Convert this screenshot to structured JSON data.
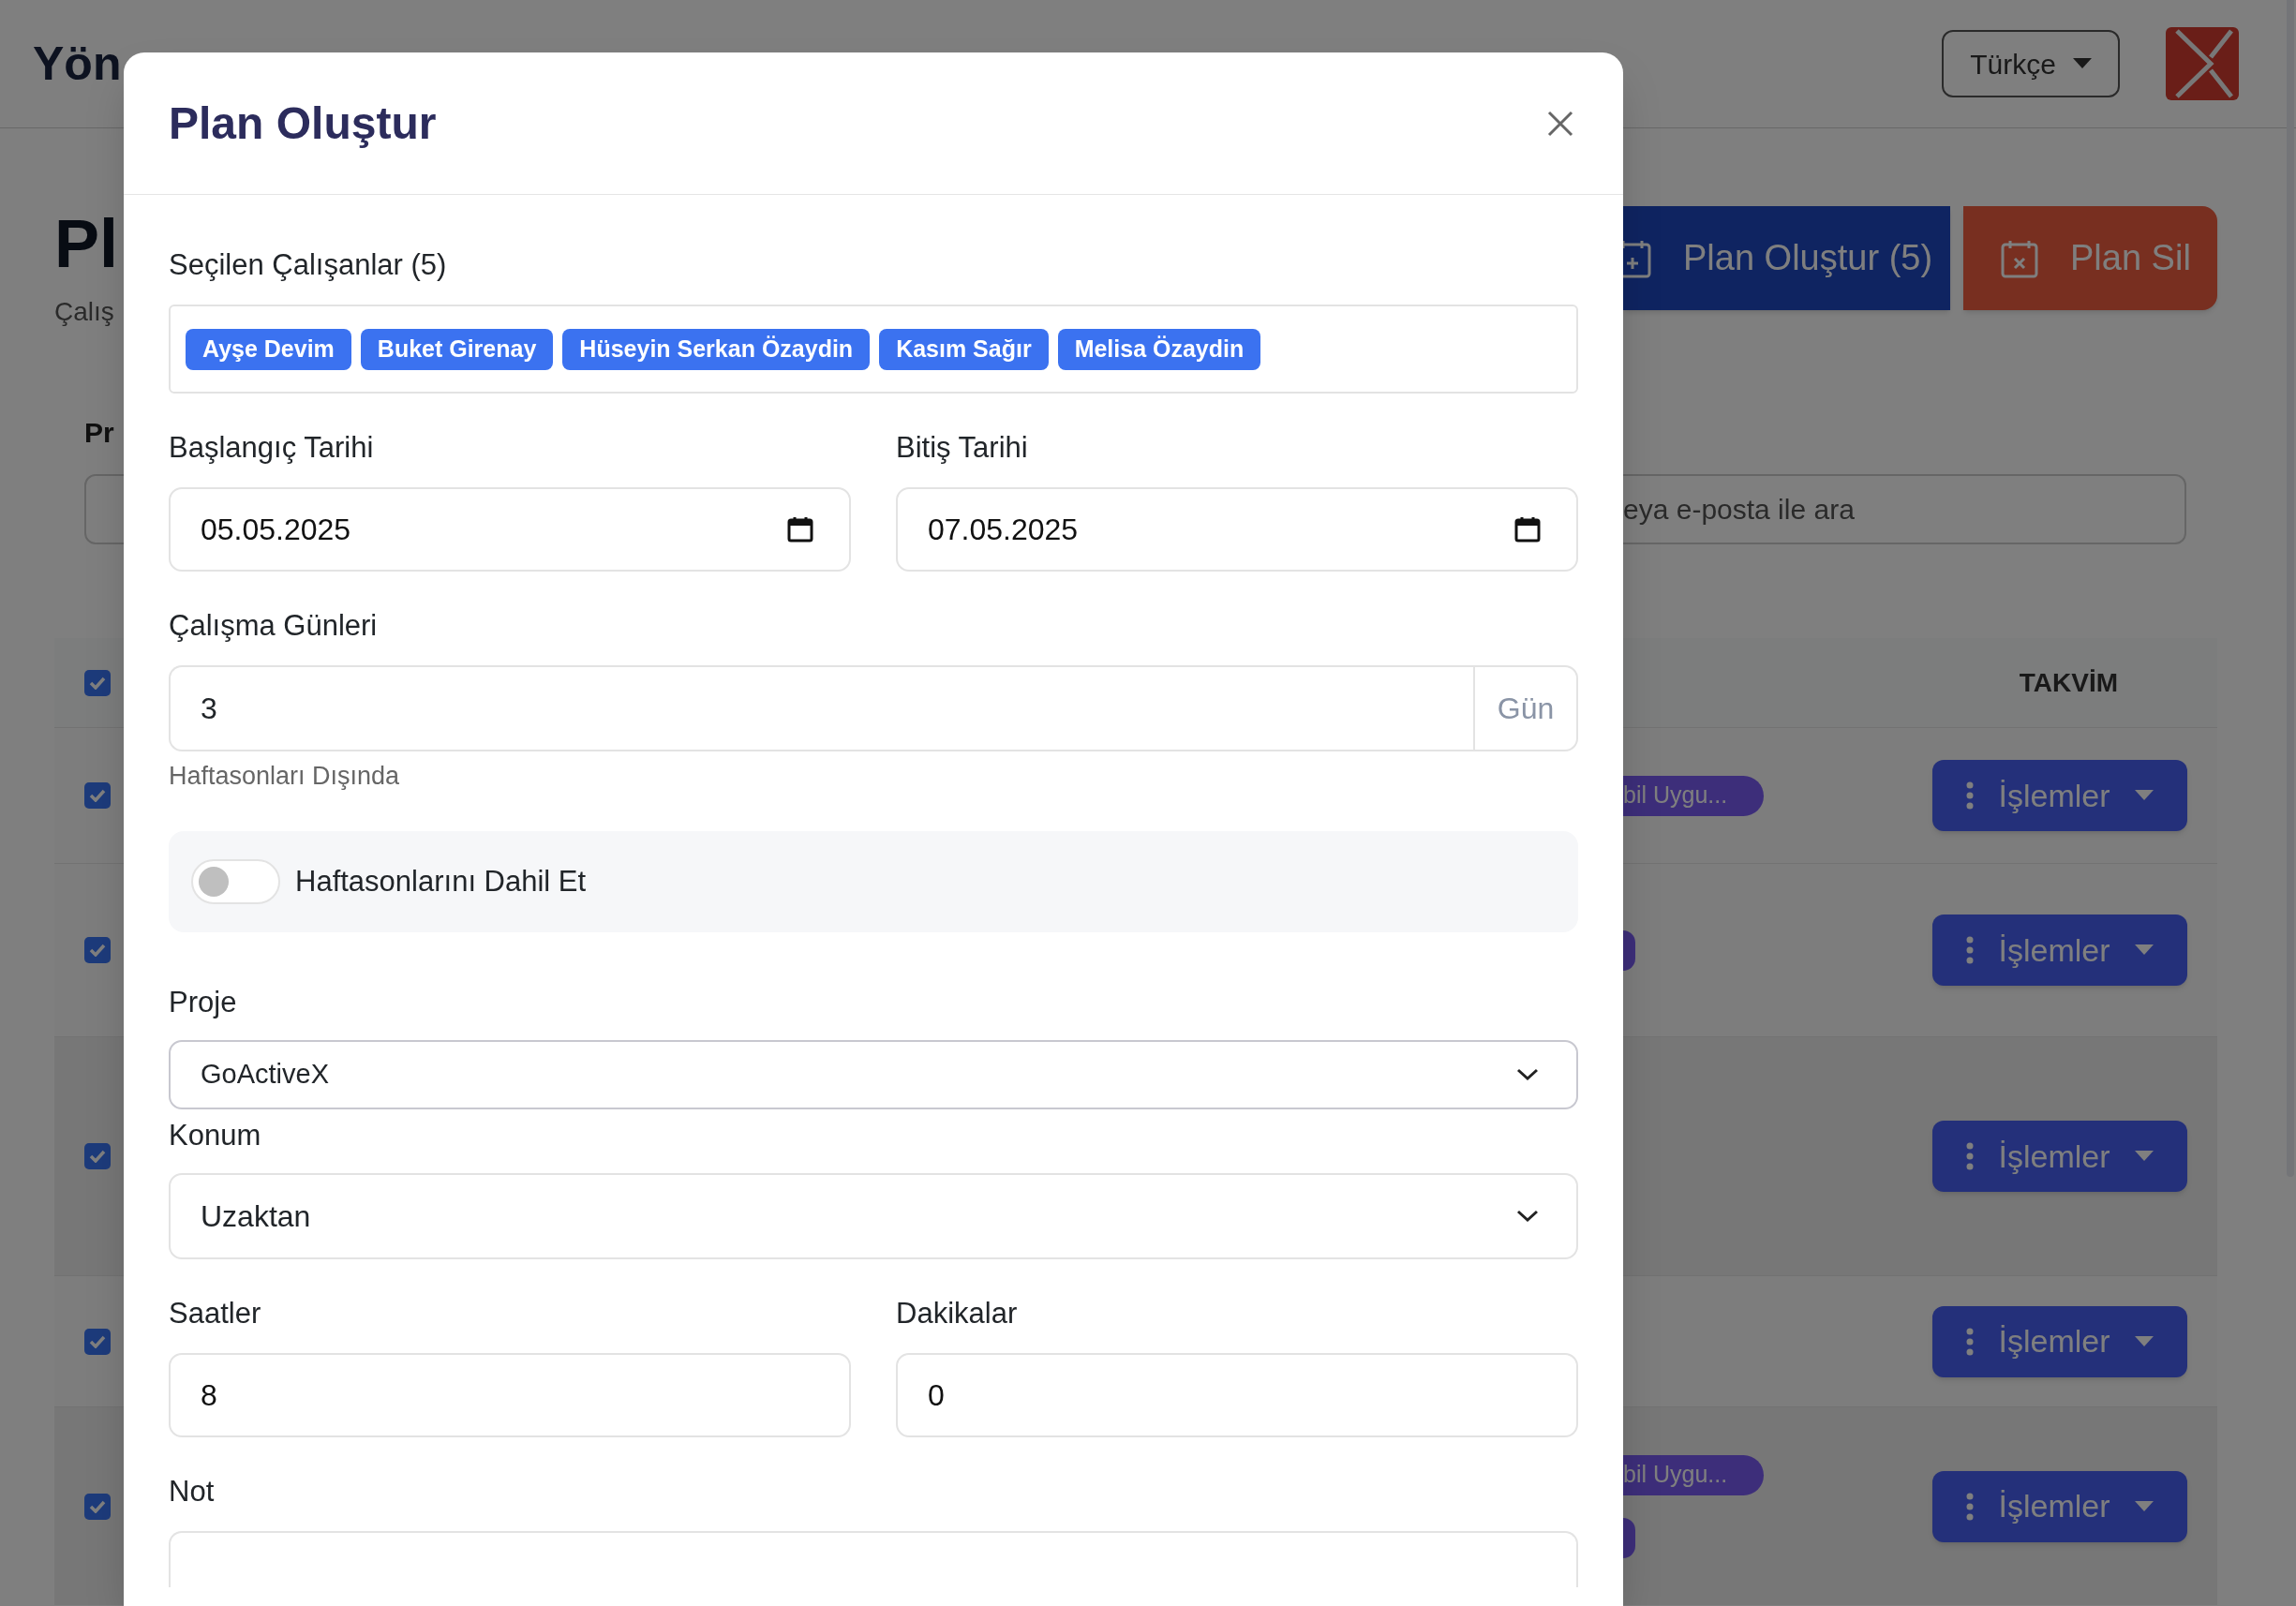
{
  "background": {
    "header": {
      "title": "Yön",
      "language": "Türkçe"
    },
    "page": {
      "title": "Pl",
      "subtitle": "Çalış",
      "create_button": "Plan Oluştur (5)",
      "delete_button": "Plan Sil"
    },
    "filters": {
      "project_label": "Pr",
      "search_placeholder": "eya e-posta ile ara"
    },
    "table": {
      "select_all": true,
      "column_heading": "TAKVİM",
      "rows": [
        {
          "checked": true,
          "tags": [
            {
              "kind": "text",
              "text": "bil Uygu..."
            }
          ],
          "action": "İşlemler"
        },
        {
          "checked": true,
          "tags": [
            {
              "kind": "stub"
            }
          ],
          "action": "İşlemler"
        },
        {
          "checked": true,
          "action": "İşlemler"
        },
        {
          "checked": true,
          "action": "İşlemler"
        },
        {
          "checked": true,
          "tags": [
            {
              "kind": "text",
              "text": "bil Uygu..."
            },
            {
              "kind": "stub"
            }
          ],
          "action": "İşlemler"
        }
      ]
    }
  },
  "modal": {
    "title": "Plan Oluştur",
    "selected_label": "Seçilen Çalışanlar (5)",
    "selected_employees": [
      "Ayşe Devim",
      "Buket Girenay",
      "Hüseyin Serkan Özaydin",
      "Kasım Sağır",
      "Melisa Özaydin"
    ],
    "start_date": {
      "label": "Başlangıç Tarihi",
      "value": "05.05.2025"
    },
    "end_date": {
      "label": "Bitiş Tarihi",
      "value": "07.05.2025"
    },
    "working_days": {
      "label": "Çalışma Günleri",
      "value": "3",
      "unit": "Gün",
      "hint": "Haftasonları Dışında"
    },
    "include_weekends": {
      "label": "Haftasonlarını Dahil Et",
      "on": false
    },
    "project": {
      "label": "Proje",
      "value": "GoActiveX"
    },
    "location": {
      "label": "Konum",
      "value": "Uzaktan"
    },
    "hours": {
      "label": "Saatler",
      "value": "8"
    },
    "minutes": {
      "label": "Dakikalar",
      "value": "0"
    },
    "note": {
      "label": "Not"
    }
  }
}
